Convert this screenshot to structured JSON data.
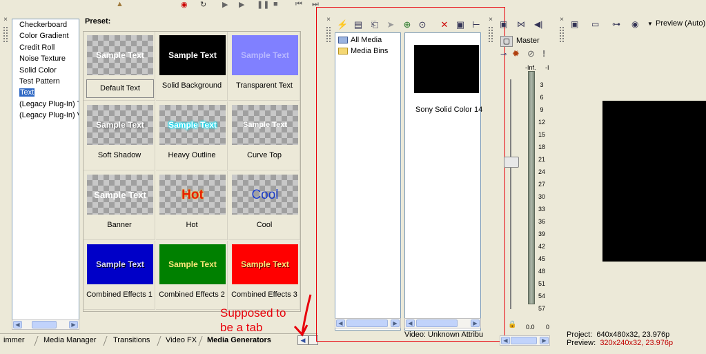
{
  "generators": {
    "items": [
      {
        "label": "Checkerboard"
      },
      {
        "label": "Color Gradient"
      },
      {
        "label": "Credit Roll"
      },
      {
        "label": "Noise Texture"
      },
      {
        "label": "Solid Color"
      },
      {
        "label": "Test Pattern"
      },
      {
        "label": "Text",
        "selected": true
      },
      {
        "label": "(Legacy Plug-In) Te"
      },
      {
        "label": "(Legacy Plug-In) Vi"
      }
    ]
  },
  "preset": {
    "label": "Preset:",
    "items": [
      {
        "name": "Default Text",
        "thumb_text": "Sample Text",
        "selected": true
      },
      {
        "name": "Solid Background",
        "thumb_text": "Sample Text"
      },
      {
        "name": "Transparent Text",
        "thumb_text": "Sample Text"
      },
      {
        "name": "Soft Shadow",
        "thumb_text": "Sample Text"
      },
      {
        "name": "Heavy Outline",
        "thumb_text": "Sample Text"
      },
      {
        "name": "Curve Top",
        "thumb_text": "Sample Text"
      },
      {
        "name": "Banner",
        "thumb_text": "Sample Text"
      },
      {
        "name": "Hot",
        "thumb_text": "Hot"
      },
      {
        "name": "Cool",
        "thumb_text": "Cool"
      },
      {
        "name": "Combined Effects 1",
        "thumb_text": "Sample Text"
      },
      {
        "name": "Combined Effects 2",
        "thumb_text": "Sample Text"
      },
      {
        "name": "Combined Effects 3",
        "thumb_text": "Sample Text"
      }
    ]
  },
  "tabs": [
    {
      "label": "immer"
    },
    {
      "label": "Media Manager"
    },
    {
      "label": "Transitions"
    },
    {
      "label": "Video FX"
    },
    {
      "label": "Media Generators",
      "active": true
    }
  ],
  "annotation": {
    "text": "Supposed to be a tab",
    "color": "#e8000a"
  },
  "media_manager": {
    "tree": [
      {
        "label": "All Media"
      },
      {
        "label": "Media Bins"
      }
    ],
    "file": {
      "label": "Sony Solid Color 14"
    },
    "status": "Video: Unknown Attribu"
  },
  "mixer": {
    "title": "Master",
    "peak_left": "-Inf.",
    "peak_right": "-I",
    "scale": [
      "3",
      "6",
      "9",
      "12",
      "15",
      "18",
      "21",
      "24",
      "27",
      "30",
      "33",
      "36",
      "39",
      "42",
      "45",
      "48",
      "51",
      "54",
      "57"
    ],
    "level_left": "0.0",
    "level_right": "0"
  },
  "preview": {
    "mode": "Preview (Auto)",
    "project_label": "Project:",
    "project_value": "640x480x32, 23.976p",
    "preview_label": "Preview:",
    "preview_value": "320x240x32, 23.976p"
  },
  "colors": {
    "selection": "#316ac5",
    "annotation": "#e8000a",
    "panel": "#ece9d8"
  }
}
